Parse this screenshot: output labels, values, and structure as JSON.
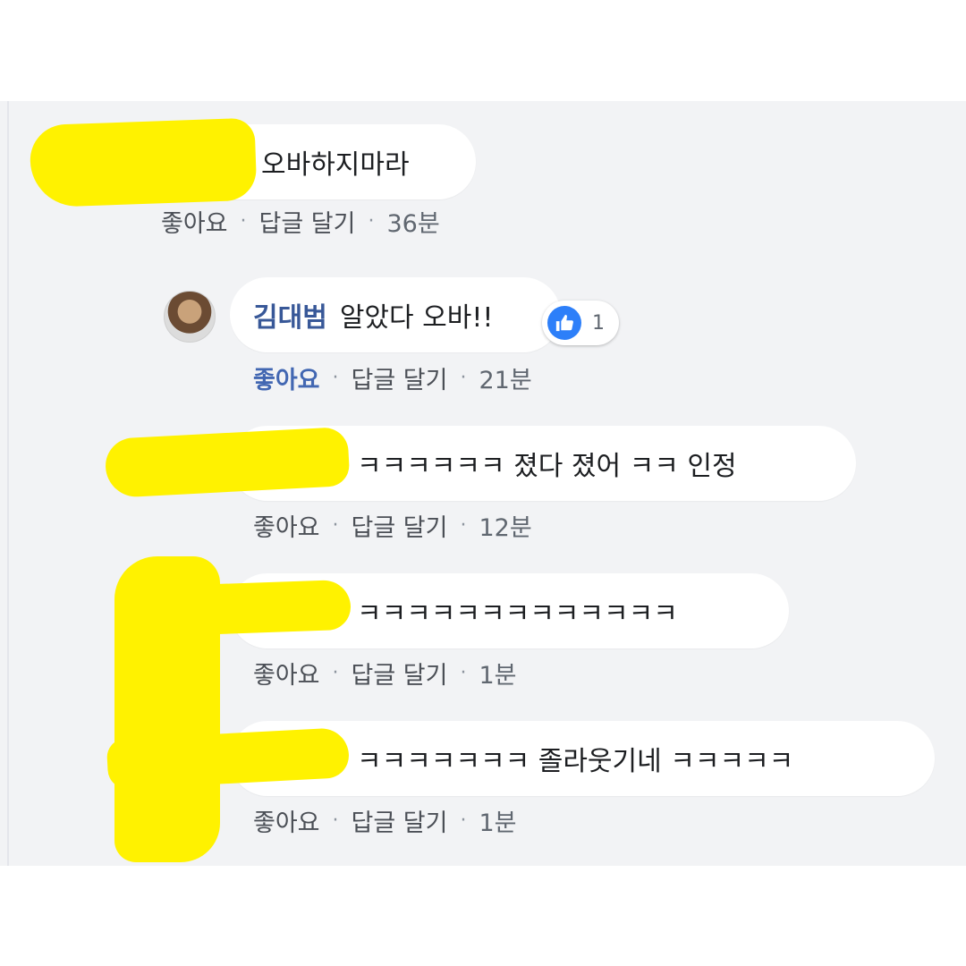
{
  "comments": [
    {
      "author": "",
      "text": "오바하지마라",
      "like_label": "좋아요",
      "reply_label": "답글 달기",
      "time": "36분"
    },
    {
      "author": "김대범",
      "text": "알았다 오바!!",
      "like_label": "좋아요",
      "reply_label": "답글 달기",
      "time": "21분",
      "reaction_count": "1",
      "reaction_icon": "thumbs-up-icon",
      "liked": true
    },
    {
      "author": "",
      "text": "ㅋㅋㅋㅋㅋㅋ 졌다 졌어 ㅋㅋ 인정",
      "like_label": "좋아요",
      "reply_label": "답글 달기",
      "time": "12분"
    },
    {
      "author": "",
      "text": "ㅋㅋㅋㅋㅋㅋㅋㅋㅋㅋㅋㅋㅋ",
      "like_label": "좋아요",
      "reply_label": "답글 달기",
      "time": "1분"
    },
    {
      "author": "",
      "text": "ㅋㅋㅋㅋㅋㅋㅋ 졸라웃기네 ㅋㅋㅋㅋㅋ",
      "like_label": "좋아요",
      "reply_label": "답글 달기",
      "time": "1분"
    }
  ],
  "colors": {
    "panel": "#f2f3f5",
    "bubble": "#ffffff",
    "author": "#385898",
    "liked": "#4267b2",
    "redaction": "#fff200",
    "reaction": "#2d7ff9"
  }
}
